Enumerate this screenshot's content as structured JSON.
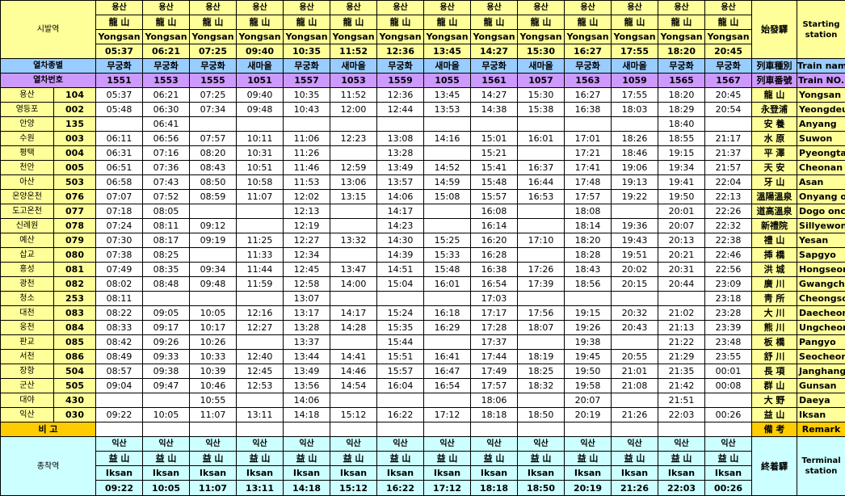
{
  "labels": {
    "origin_ko": "시발역",
    "origin_hanja": "始發驛",
    "origin_en": "Starting station",
    "type_ko": "열차종별",
    "type_hanja": "列車種別",
    "type_en": "Train name",
    "number_ko": "열차번호",
    "number_hanja": "列車番號",
    "number_en": "Train NO.",
    "remark_ko": "비 고",
    "remark_hanja": "備  考",
    "remark_en": "Remark",
    "terminal_ko": "종착역",
    "terminal_hanja": "終着驛",
    "terminal_en": "Terminal station"
  },
  "trains": [
    {
      "origin_ko": "용산",
      "origin_hanja": "龍 山",
      "origin_en": "Yongsan",
      "origin_time": "05:37",
      "type": "무궁화",
      "number": "1551",
      "dest_ko": "익산",
      "dest_hanja": "益 山",
      "dest_en": "Iksan",
      "dest_time": "09:22"
    },
    {
      "origin_ko": "용산",
      "origin_hanja": "龍 山",
      "origin_en": "Yongsan",
      "origin_time": "06:21",
      "type": "무궁화",
      "number": "1553",
      "dest_ko": "익산",
      "dest_hanja": "益 山",
      "dest_en": "Iksan",
      "dest_time": "10:05"
    },
    {
      "origin_ko": "용산",
      "origin_hanja": "龍 山",
      "origin_en": "Yongsan",
      "origin_time": "07:25",
      "type": "무궁화",
      "number": "1555",
      "dest_ko": "익산",
      "dest_hanja": "益 山",
      "dest_en": "Iksan",
      "dest_time": "11:07"
    },
    {
      "origin_ko": "용산",
      "origin_hanja": "龍 山",
      "origin_en": "Yongsan",
      "origin_time": "09:40",
      "type": "새마을",
      "number": "1051",
      "dest_ko": "익산",
      "dest_hanja": "益 山",
      "dest_en": "Iksan",
      "dest_time": "13:11"
    },
    {
      "origin_ko": "용산",
      "origin_hanja": "龍 山",
      "origin_en": "Yongsan",
      "origin_time": "10:35",
      "type": "무궁화",
      "number": "1557",
      "dest_ko": "익산",
      "dest_hanja": "益 山",
      "dest_en": "Iksan",
      "dest_time": "14:18"
    },
    {
      "origin_ko": "용산",
      "origin_hanja": "龍 山",
      "origin_en": "Yongsan",
      "origin_time": "11:52",
      "type": "새마을",
      "number": "1053",
      "dest_ko": "익산",
      "dest_hanja": "益 山",
      "dest_en": "Iksan",
      "dest_time": "15:12"
    },
    {
      "origin_ko": "용산",
      "origin_hanja": "龍 山",
      "origin_en": "Yongsan",
      "origin_time": "12:36",
      "type": "무궁화",
      "number": "1559",
      "dest_ko": "익산",
      "dest_hanja": "益 山",
      "dest_en": "Iksan",
      "dest_time": "16:22"
    },
    {
      "origin_ko": "용산",
      "origin_hanja": "龍 山",
      "origin_en": "Yongsan",
      "origin_time": "13:45",
      "type": "새마을",
      "number": "1055",
      "dest_ko": "익산",
      "dest_hanja": "益 山",
      "dest_en": "Iksan",
      "dest_time": "17:12"
    },
    {
      "origin_ko": "용산",
      "origin_hanja": "龍 山",
      "origin_en": "Yongsan",
      "origin_time": "14:27",
      "type": "무궁화",
      "number": "1561",
      "dest_ko": "익산",
      "dest_hanja": "益 山",
      "dest_en": "Iksan",
      "dest_time": "18:18"
    },
    {
      "origin_ko": "용산",
      "origin_hanja": "龍 山",
      "origin_en": "Yongsan",
      "origin_time": "15:30",
      "type": "새마을",
      "number": "1057",
      "dest_ko": "익산",
      "dest_hanja": "益 山",
      "dest_en": "Iksan",
      "dest_time": "18:50"
    },
    {
      "origin_ko": "용산",
      "origin_hanja": "龍 山",
      "origin_en": "Yongsan",
      "origin_time": "16:27",
      "type": "무궁화",
      "number": "1563",
      "dest_ko": "익산",
      "dest_hanja": "益 山",
      "dest_en": "Iksan",
      "dest_time": "20:19"
    },
    {
      "origin_ko": "용산",
      "origin_hanja": "龍 山",
      "origin_en": "Yongsan",
      "origin_time": "17:55",
      "type": "새마을",
      "number": "1059",
      "dest_ko": "익산",
      "dest_hanja": "益 山",
      "dest_en": "Iksan",
      "dest_time": "21:26"
    },
    {
      "origin_ko": "용산",
      "origin_hanja": "龍 山",
      "origin_en": "Yongsan",
      "origin_time": "18:20",
      "type": "무궁화",
      "number": "1565",
      "dest_ko": "익산",
      "dest_hanja": "益 山",
      "dest_en": "Iksan",
      "dest_time": "22:03"
    },
    {
      "origin_ko": "용산",
      "origin_hanja": "龍 山",
      "origin_en": "Yongsan",
      "origin_time": "20:45",
      "type": "무궁화",
      "number": "1567",
      "dest_ko": "익산",
      "dest_hanja": "益 山",
      "dest_en": "Iksan",
      "dest_time": "00:26"
    }
  ],
  "stations": [
    {
      "ko": "용산",
      "code": "104",
      "hanja": "龍 山",
      "en": "Yongsan",
      "times": [
        "05:37",
        "06:21",
        "07:25",
        "09:40",
        "10:35",
        "11:52",
        "12:36",
        "13:45",
        "14:27",
        "15:30",
        "16:27",
        "17:55",
        "18:20",
        "20:45"
      ]
    },
    {
      "ko": "영등포",
      "code": "002",
      "hanja": "永登浦",
      "en": "Yeongdeungpo",
      "times": [
        "05:48",
        "06:30",
        "07:34",
        "09:48",
        "10:43",
        "12:00",
        "12:44",
        "13:53",
        "14:38",
        "15:38",
        "16:38",
        "18:03",
        "18:29",
        "20:54"
      ]
    },
    {
      "ko": "안양",
      "code": "135",
      "hanja": "安 養",
      "en": "Anyang",
      "times": [
        "",
        "06:41",
        "",
        "",
        "",
        "",
        "",
        "",
        "",
        "",
        "",
        "",
        "18:40",
        ""
      ]
    },
    {
      "ko": "수원",
      "code": "003",
      "hanja": "水 原",
      "en": "Suwon",
      "times": [
        "06:11",
        "06:56",
        "07:57",
        "10:11",
        "11:06",
        "12:23",
        "13:08",
        "14:16",
        "15:01",
        "16:01",
        "17:01",
        "18:26",
        "18:55",
        "21:17"
      ]
    },
    {
      "ko": "평택",
      "code": "004",
      "hanja": "平 澤",
      "en": "Pyeongtaek",
      "times": [
        "06:31",
        "07:16",
        "08:20",
        "10:31",
        "11:26",
        "",
        "13:28",
        "",
        "15:21",
        "",
        "17:21",
        "18:46",
        "19:15",
        "21:37"
      ]
    },
    {
      "ko": "천안",
      "code": "005",
      "hanja": "天 安",
      "en": "Cheonan",
      "times": [
        "06:51",
        "07:36",
        "08:43",
        "10:51",
        "11:46",
        "12:59",
        "13:49",
        "14:52",
        "15:41",
        "16:37",
        "17:41",
        "19:06",
        "19:34",
        "21:57"
      ]
    },
    {
      "ko": "아산",
      "code": "503",
      "hanja": "牙 山",
      "en": "Asan",
      "times": [
        "06:58",
        "07:43",
        "08:50",
        "10:58",
        "11:53",
        "13:06",
        "13:57",
        "14:59",
        "15:48",
        "16:44",
        "17:48",
        "19:13",
        "19:41",
        "22:04"
      ]
    },
    {
      "ko": "온양온천",
      "code": "076",
      "hanja": "溫陽溫泉",
      "en": "Onyang oncheon",
      "times": [
        "07:07",
        "07:52",
        "08:59",
        "11:07",
        "12:02",
        "13:15",
        "14:06",
        "15:08",
        "15:57",
        "16:53",
        "17:57",
        "19:22",
        "19:50",
        "22:13"
      ]
    },
    {
      "ko": "도고온천",
      "code": "077",
      "hanja": "道高溫泉",
      "en": "Dogo oncheon",
      "times": [
        "07:18",
        "08:05",
        "",
        "",
        "12:13",
        "",
        "14:17",
        "",
        "16:08",
        "",
        "18:08",
        "",
        "20:01",
        "22:26"
      ]
    },
    {
      "ko": "신례원",
      "code": "078",
      "hanja": "新禮院",
      "en": "Sillyewon",
      "times": [
        "07:24",
        "08:11",
        "09:12",
        "",
        "12:19",
        "",
        "14:23",
        "",
        "16:14",
        "",
        "18:14",
        "19:36",
        "20:07",
        "22:32"
      ]
    },
    {
      "ko": "예산",
      "code": "079",
      "hanja": "禮 山",
      "en": "Yesan",
      "times": [
        "07:30",
        "08:17",
        "09:19",
        "11:25",
        "12:27",
        "13:32",
        "14:30",
        "15:25",
        "16:20",
        "17:10",
        "18:20",
        "19:43",
        "20:13",
        "22:38"
      ]
    },
    {
      "ko": "삽교",
      "code": "080",
      "hanja": "揷 橋",
      "en": "Sapgyo",
      "times": [
        "07:38",
        "08:25",
        "",
        "11:33",
        "12:34",
        "",
        "14:39",
        "15:33",
        "16:28",
        "",
        "18:28",
        "19:51",
        "20:21",
        "22:46"
      ]
    },
    {
      "ko": "홍성",
      "code": "081",
      "hanja": "洪 城",
      "en": "Hongseong",
      "times": [
        "07:49",
        "08:35",
        "09:34",
        "11:44",
        "12:45",
        "13:47",
        "14:51",
        "15:48",
        "16:38",
        "17:26",
        "18:43",
        "20:02",
        "20:31",
        "22:56"
      ]
    },
    {
      "ko": "광천",
      "code": "082",
      "hanja": "廣 川",
      "en": "Gwangcheon",
      "times": [
        "08:02",
        "08:48",
        "09:48",
        "11:59",
        "12:58",
        "14:00",
        "15:04",
        "16:01",
        "16:54",
        "17:39",
        "18:56",
        "20:15",
        "20:44",
        "23:09"
      ]
    },
    {
      "ko": "청소",
      "code": "253",
      "hanja": "靑 所",
      "en": "Cheongso",
      "times": [
        "08:11",
        "",
        "",
        "",
        "13:07",
        "",
        "",
        "",
        "17:03",
        "",
        "",
        "",
        "",
        "23:18"
      ]
    },
    {
      "ko": "대천",
      "code": "083",
      "hanja": "大 川",
      "en": "Daecheon",
      "times": [
        "08:22",
        "09:05",
        "10:05",
        "12:16",
        "13:17",
        "14:17",
        "15:24",
        "16:18",
        "17:17",
        "17:56",
        "19:15",
        "20:32",
        "21:02",
        "23:28"
      ]
    },
    {
      "ko": "웅천",
      "code": "084",
      "hanja": "熊 川",
      "en": "Ungcheon",
      "times": [
        "08:33",
        "09:17",
        "10:17",
        "12:27",
        "13:28",
        "14:28",
        "15:35",
        "16:29",
        "17:28",
        "18:07",
        "19:26",
        "20:43",
        "21:13",
        "23:39"
      ]
    },
    {
      "ko": "판교",
      "code": "085",
      "hanja": "板 橋",
      "en": "Pangyo",
      "times": [
        "08:42",
        "09:26",
        "10:26",
        "",
        "13:37",
        "",
        "15:44",
        "",
        "17:37",
        "",
        "19:38",
        "",
        "21:22",
        "23:48"
      ]
    },
    {
      "ko": "서천",
      "code": "086",
      "hanja": "舒 川",
      "en": "Seocheon",
      "times": [
        "08:49",
        "09:33",
        "10:33",
        "12:40",
        "13:44",
        "14:41",
        "15:51",
        "16:41",
        "17:44",
        "18:19",
        "19:45",
        "20:55",
        "21:29",
        "23:55"
      ]
    },
    {
      "ko": "장항",
      "code": "504",
      "hanja": "長 項",
      "en": "Janghang",
      "times": [
        "08:57",
        "09:38",
        "10:39",
        "12:45",
        "13:49",
        "14:46",
        "15:57",
        "16:47",
        "17:49",
        "18:25",
        "19:50",
        "21:01",
        "21:35",
        "00:01"
      ]
    },
    {
      "ko": "군산",
      "code": "505",
      "hanja": "群 山",
      "en": "Gunsan",
      "times": [
        "09:04",
        "09:47",
        "10:46",
        "12:53",
        "13:56",
        "14:54",
        "16:04",
        "16:54",
        "17:57",
        "18:32",
        "19:58",
        "21:08",
        "21:42",
        "00:08"
      ]
    },
    {
      "ko": "대야",
      "code": "430",
      "hanja": "大 野",
      "en": "Daeya",
      "times": [
        "",
        "",
        "10:55",
        "",
        "14:06",
        "",
        "",
        "",
        "18:06",
        "",
        "20:07",
        "",
        "21:51",
        ""
      ]
    },
    {
      "ko": "익산",
      "code": "030",
      "hanja": "益 山",
      "en": "Iksan",
      "times": [
        "09:22",
        "10:05",
        "11:07",
        "13:11",
        "14:18",
        "15:12",
        "16:22",
        "17:12",
        "18:18",
        "18:50",
        "20:19",
        "21:26",
        "22:03",
        "00:26"
      ]
    }
  ]
}
